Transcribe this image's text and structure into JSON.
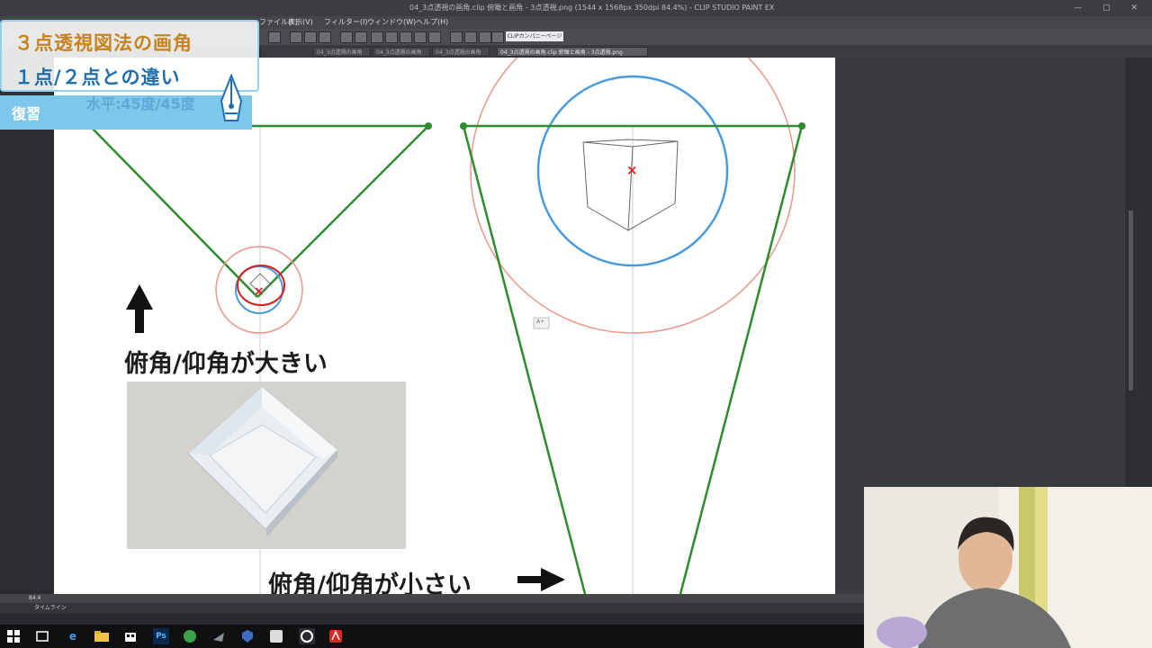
{
  "window": {
    "title": "04_3点透視の画角.clip   俯瞰と画角 - 3点透視.png (1544 x 1568px 350dpi 84.4%)  - CLIP STUDIO PAINT EX",
    "controls": "— ▢ ✕"
  },
  "menu": [
    "ファイル(F)",
    "表示(V)",
    "フィルター(I)",
    "ウィンドウ(W)",
    "ヘルプ(H)"
  ],
  "toolbar": {
    "homepage_button": "CLIPカンパニーページ"
  },
  "tabs": [
    {
      "label": "04_3点透視の画角",
      "active": false
    },
    {
      "label": "04_3点透視の画角",
      "active": false
    },
    {
      "label": "04_3点透視の画角",
      "active": false
    },
    {
      "label": "04_3点透視の画角.clip   俯瞰と画角 - 3点透視.png",
      "active": true
    }
  ],
  "overlay": {
    "title_line1": "３点透視図法の画角",
    "title_line2": "１点/２点との違い",
    "band_label": "復習",
    "ghost_text": "水平:45度/45度",
    "pen_icon": "fountain-pen-icon"
  },
  "canvas": {
    "label_large_angle": "俯角/仰角が大きい",
    "label_small_angle": "俯角/仰角が小さい",
    "arrow_up": "up-arrow-icon",
    "arrow_right": "right-arrow-icon",
    "tooltip_text": "A+",
    "colors": {
      "green": "#2e8b2e",
      "blue": "#4a9bdc",
      "red_circle": "#e8968c",
      "center_x": "#e02020",
      "bg": "#ffffff"
    }
  },
  "status": {
    "zoom": "84.4"
  },
  "timeline": {
    "label": "タイムライン"
  },
  "taskbar": {
    "icons": [
      "windows-start-icon",
      "task-view-icon",
      "edge-icon",
      "file-explorer-icon",
      "store-icon",
      "photoshop-icon",
      "app-icon",
      "app-icon",
      "app-icon",
      "app-icon",
      "clip-studio-icon",
      "acrobat-icon"
    ],
    "photoshop_label": "Ps"
  }
}
